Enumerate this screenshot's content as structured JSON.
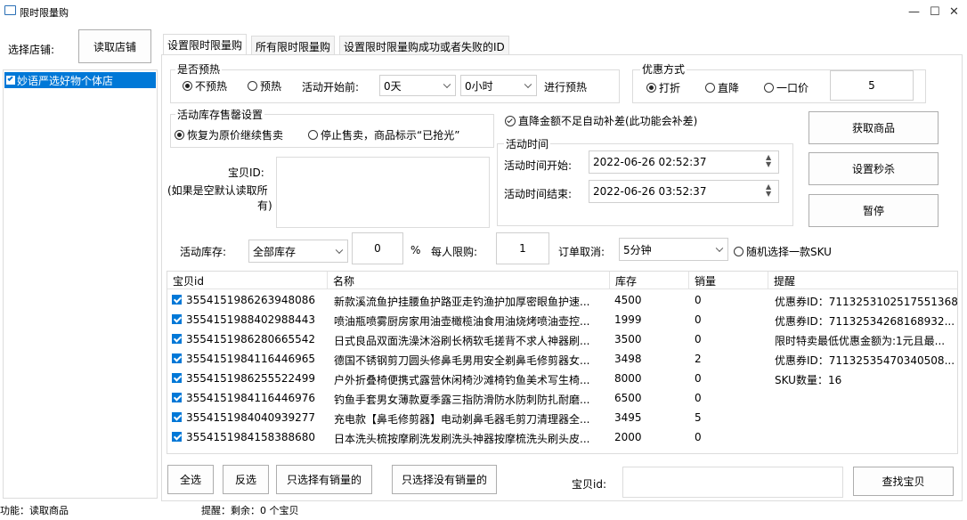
{
  "window": {
    "title": "限时限量购"
  },
  "left": {
    "store_label": "选择店铺:",
    "read_store_button": "读取店铺",
    "stores": [
      "妙语严选好物个体店"
    ]
  },
  "tabs": [
    "设置限时限量购",
    "所有限时限量购",
    "设置限时限量购成功或者失败的ID"
  ],
  "presale": {
    "title": "是否预热",
    "options": [
      "不预热",
      "预热"
    ],
    "selected": 0,
    "before_label": "活动开始前:",
    "days": "0天",
    "hours": "0小时",
    "suffix": "进行预热"
  },
  "discount": {
    "title": "优惠方式",
    "options": [
      "打折",
      "直降",
      "一口价"
    ],
    "selected": 0,
    "value": "5"
  },
  "stock_sellout": {
    "title": "活动库存售罄设置",
    "options": [
      "恢复为原价继续售卖",
      "停止售卖，商品标示“已抢光”"
    ],
    "selected": 0
  },
  "auto_compensate": {
    "label": "直降金额不足自动补差(此功能会补差)",
    "checked": true
  },
  "activity_time": {
    "title": "活动时间",
    "start_label": "活动时间开始:",
    "start_value": "2022-06-26 02:52:37",
    "end_label": "活动时间结束:",
    "end_value": "2022-06-26 03:52:37"
  },
  "product_id": {
    "label_line1": "宝贝ID:",
    "label_line2": "(如果是空默认读取所",
    "label_line3": "有)"
  },
  "right_buttons": {
    "get_products": "获取商品",
    "set_flash": "设置秒杀",
    "pause": "暂停"
  },
  "options_row": {
    "stock_label": "活动库存:",
    "stock_select": "全部库存",
    "stock_value": "0",
    "percent": "%",
    "limit_label": "每人限购:",
    "limit_value": "1",
    "cancel_label": "订单取消:",
    "cancel_select": "5分钟",
    "random_sku": "随机选择一款SKU"
  },
  "table": {
    "headers": [
      "宝贝id",
      "名称",
      "库存",
      "销量",
      "提醒"
    ],
    "rows": [
      {
        "id": "3554151986263948086",
        "name": "新款溪流鱼护挂腰鱼护路亚走钓渔护加厚密眼鱼护速...",
        "stock": "4500",
        "sales": "0",
        "note": "优惠券ID：7113253102517551368"
      },
      {
        "id": "3554151988402988443",
        "name": "喷油瓶喷雾厨房家用油壶橄榄油食用油烧烤喷油壶控...",
        "stock": "1999",
        "sales": "0",
        "note": "优惠券ID：71132534268168932..."
      },
      {
        "id": "3554151986280665542",
        "name": "日式良品双面洗澡沐浴刷长柄软毛搓背不求人神器刷...",
        "stock": "3500",
        "sales": "0",
        "note": "限时特卖最低优惠金额为:1元且最..."
      },
      {
        "id": "3554151984116446965",
        "name": "德国不锈钢剪刀圆头修鼻毛男用安全剃鼻毛修剪器女...",
        "stock": "3498",
        "sales": "2",
        "note": "优惠券ID：71132535470340508..."
      },
      {
        "id": "3554151986255522499",
        "name": "户外折叠椅便携式露营休闲椅沙滩椅钓鱼美术写生椅...",
        "stock": "8000",
        "sales": "0",
        "note": "SKU数量：16"
      },
      {
        "id": "3554151984116446976",
        "name": "钓鱼手套男女薄款夏季露三指防滑防水防刺防扎耐磨...",
        "stock": "6500",
        "sales": "0",
        "note": ""
      },
      {
        "id": "3554151984040939277",
        "name": "充电款【鼻毛修剪器】电动剃鼻毛器毛剪刀清理器全...",
        "stock": "3495",
        "sales": "5",
        "note": ""
      },
      {
        "id": "3554151984158388680",
        "name": "日本洗头梳按摩刷洗发刷洗头神器按摩梳洗头刷头皮...",
        "stock": "2000",
        "sales": "0",
        "note": ""
      }
    ]
  },
  "bottom": {
    "select_all": "全选",
    "invert": "反选",
    "only_sold": "只选择有销量的",
    "only_unsold": "只选择没有销量的",
    "id_label": "宝贝id:",
    "find": "查找宝贝"
  },
  "status": {
    "left": "功能：读取商品",
    "right": "提醒：剩余：0 个宝贝"
  },
  "colors": {
    "accent": "#0078d7",
    "selected_bg": "#0078d7"
  }
}
